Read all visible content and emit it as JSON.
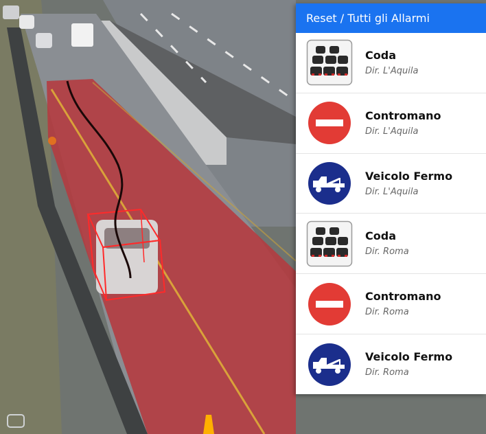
{
  "panel": {
    "header_label": "Reset / Tutti gli Allarmi",
    "colors": {
      "header": "#1a73f0",
      "wrong_way": "#e23b35",
      "stopped_vehicle": "#1b2e8c"
    },
    "items": [
      {
        "title": "Coda",
        "direction": "Dir. L'Aquila",
        "icon": "traffic-queue-icon"
      },
      {
        "title": "Contromano",
        "direction": "Dir. L'Aquila",
        "icon": "no-entry-icon"
      },
      {
        "title": "Veicolo Fermo",
        "direction": "Dir. L'Aquila",
        "icon": "tow-truck-icon"
      },
      {
        "title": "Coda",
        "direction": "Dir. Roma",
        "icon": "traffic-queue-icon"
      },
      {
        "title": "Contromano",
        "direction": "Dir. Roma",
        "icon": "no-entry-icon"
      },
      {
        "title": "Veicolo Fermo",
        "direction": "Dir. Roma",
        "icon": "tow-truck-icon"
      }
    ]
  }
}
